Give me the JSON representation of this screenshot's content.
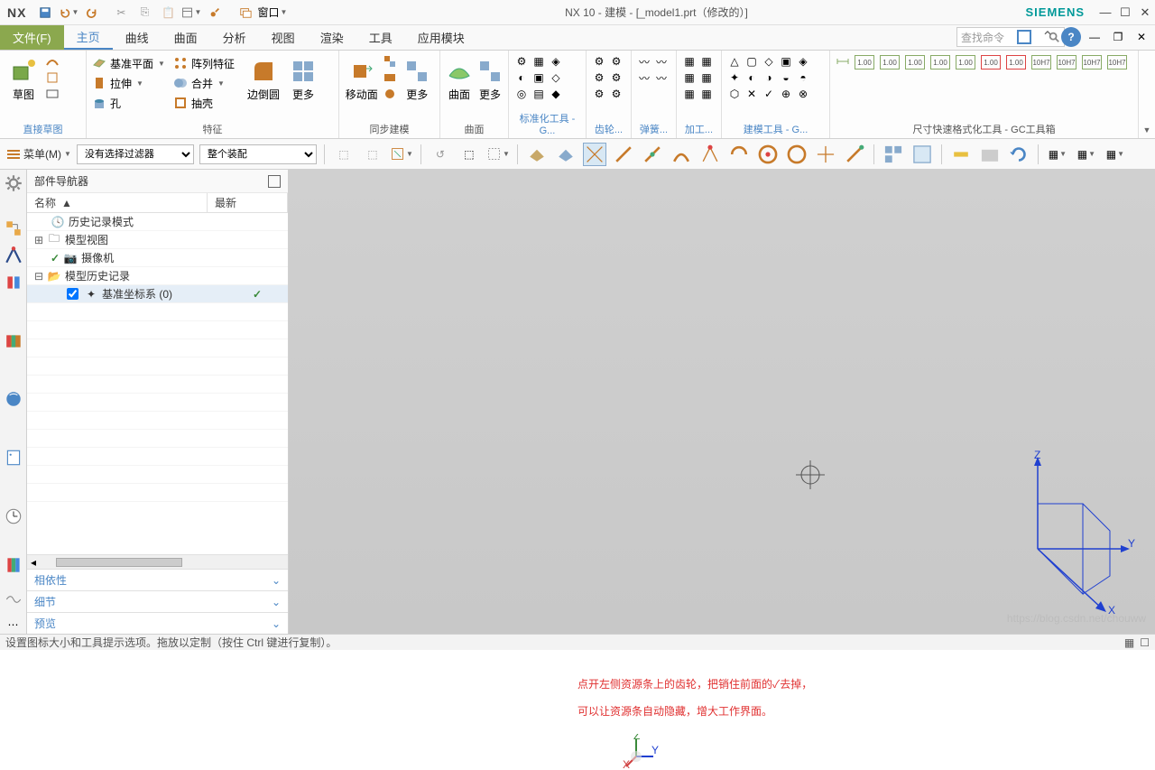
{
  "titlebar": {
    "logo": "NX",
    "window_dropdown": "窗口",
    "title": "NX 10 - 建模 - [_model1.prt（修改的）]",
    "brand": "SIEMENS"
  },
  "menubar": {
    "file": "文件(F)",
    "items": [
      "主页",
      "曲线",
      "曲面",
      "分析",
      "视图",
      "渲染",
      "工具",
      "应用模块"
    ],
    "search_placeholder": "查找命令"
  },
  "ribbon": {
    "g_sketch": {
      "title": "直接草图",
      "sketch": "草图"
    },
    "g_feature": {
      "title": "特征",
      "datum_plane": "基准平面",
      "extrude": "拉伸",
      "hole": "孔",
      "pattern": "阵列特征",
      "unite": "合并",
      "shell": "抽壳",
      "edge_blend": "边倒圆",
      "more": "更多"
    },
    "g_sync": {
      "title": "同步建模",
      "move_face": "移动面",
      "more": "更多"
    },
    "g_surface": {
      "title": "曲面",
      "surface": "曲面",
      "more": "更多"
    },
    "g_std": {
      "title": "标准化工具 - G..."
    },
    "g_gear": {
      "title": "齿轮..."
    },
    "g_spring": {
      "title": "弹簧..."
    },
    "g_machining": {
      "title": "加工..."
    },
    "g_modeling": {
      "title": "建模工具 - G..."
    },
    "g_dim": {
      "title": "尺寸快速格式化工具 - GC工具箱"
    }
  },
  "toolbar2": {
    "menu": "菜单(M)",
    "filter1": "没有选择过滤器",
    "filter2": "整个装配"
  },
  "navigator": {
    "title": "部件导航器",
    "col_name": "名称",
    "col_latest": "最新",
    "tree": {
      "history_mode": "历史记录模式",
      "model_views": "模型视图",
      "cameras": "摄像机",
      "model_history": "模型历史记录",
      "datum_csys": "基准坐标系 (0)"
    },
    "sections": {
      "dependency": "相依性",
      "detail": "细节",
      "preview": "预览"
    }
  },
  "viewport": {
    "axes": {
      "x": "X",
      "y": "Y",
      "z": "Z"
    },
    "annotation_line1": "点开左侧资源条上的齿轮，把销住前面的✓去掉，",
    "annotation_line2": "可以让资源条自动隐藏，增大工作界面。",
    "watermark": "https://blog.csdn.net/chouww"
  },
  "statusbar": {
    "text": "设置图标大小和工具提示选项。拖放以定制（按住 Ctrl 键进行复制）。"
  }
}
